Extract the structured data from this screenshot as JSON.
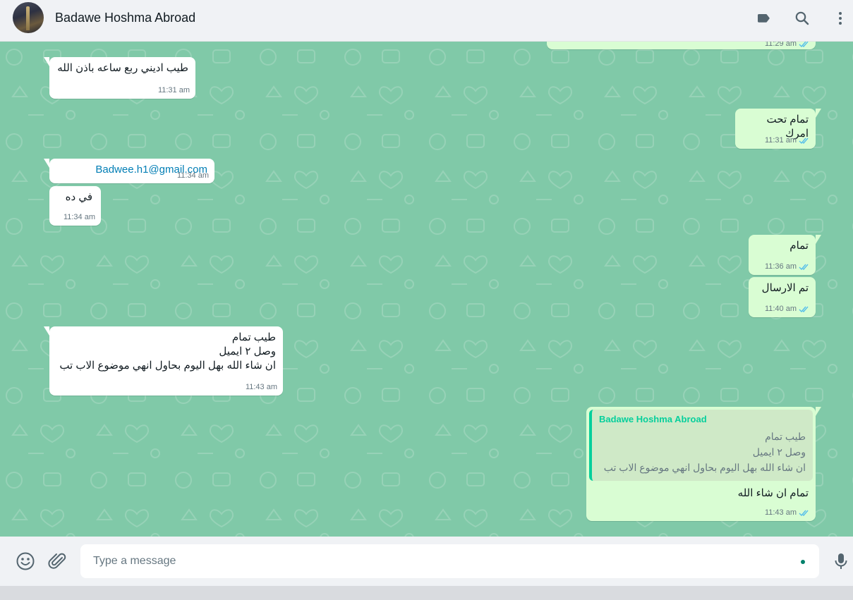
{
  "header": {
    "contact_name": "Badawe Hoshma Abroad",
    "icons": [
      "label-icon",
      "search-icon",
      "menu-icon"
    ]
  },
  "messages": [
    {
      "direction": "out",
      "time": "11:29 am",
      "status": "read"
    },
    {
      "direction": "in",
      "text": "طيب اديني ربع ساعه باذن الله",
      "time": "11:31 am"
    },
    {
      "direction": "out",
      "text": "تمام تحت امرك",
      "time": "11:31 am",
      "status": "read"
    },
    {
      "direction": "in",
      "text": "Badwee.h1@gmail.com",
      "time": "11:34 am",
      "type": "link"
    },
    {
      "direction": "in",
      "text": "في ده",
      "time": "11:34 am"
    },
    {
      "direction": "out",
      "text": "تمام",
      "time": "11:36 am",
      "status": "read"
    },
    {
      "direction": "out",
      "text": "تم الارسال",
      "time": "11:40 am",
      "status": "read"
    },
    {
      "direction": "in",
      "text": "طيب تمام\nوصل ٢ ايميل\nان شاء الله بهل اليوم بحاول انهي موضوع الاب تب",
      "time": "11:43 am"
    },
    {
      "direction": "out",
      "quote": {
        "author": "Badawe Hoshma Abroad",
        "text": "طيب تمام\nوصل ٢ ايميل\nان شاء الله بهل اليوم بحاول انهي موضوع الاب تب"
      },
      "text": "تمام ان شاء الله",
      "time": "11:43 am",
      "status": "read"
    }
  ],
  "composer": {
    "placeholder": "Type a message",
    "icons": [
      "emoji-icon",
      "attach-icon",
      "microphone-icon"
    ]
  },
  "colors": {
    "chat_background": "#80c9a8",
    "incoming_bubble": "#ffffff",
    "outgoing_bubble": "#d9fdd3",
    "read_ticks": "#53bdeb",
    "quote_accent": "#06cf9c",
    "link": "#027eb5"
  }
}
